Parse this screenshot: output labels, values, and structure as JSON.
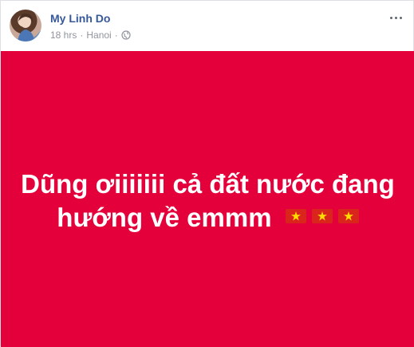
{
  "post": {
    "author_name": "My Linh Do",
    "time": "18 hrs",
    "separator": "·",
    "location": "Hanoi",
    "privacy_icon": "globe-icon",
    "more_icon": "more-options-icon"
  },
  "status": {
    "line1": "Dũng ơiiiiiii cả đất nước đang",
    "line2": "hướng về emmm",
    "emojis": [
      "vietnam-flag-icon",
      "vietnam-flag-icon",
      "vietnam-flag-icon"
    ]
  },
  "colors": {
    "background": "#e4003a",
    "name": "#365899",
    "meta": "#90949c",
    "flag_red": "#da251d",
    "flag_star": "#ffde00"
  }
}
